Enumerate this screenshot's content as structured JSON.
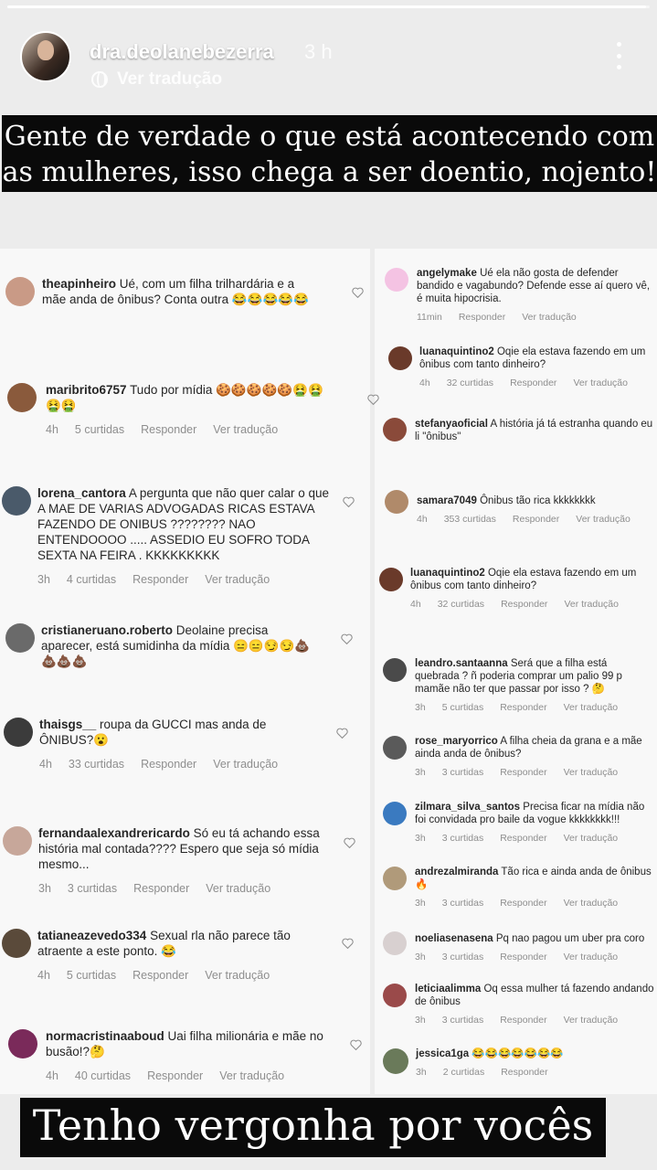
{
  "story": {
    "username": "dra.deolanebezerra",
    "time": "3 h",
    "translate_label": "Ver tradução",
    "progress": 0.995,
    "caption_top": "Gente de verdade o que está acontecendo com as mulheres, isso chega a ser doentio, nojento!",
    "caption_bottom": "Tenho vergonha por vocês"
  },
  "labels": {
    "reply": "Responder",
    "translate": "Ver tradução"
  },
  "left_comments": [
    {
      "user": "theapinheiro",
      "text": "Ué, com um filha trilhardária e a mãe anda de ônibus? Conta outra 😂😂😂😂😂",
      "time": "",
      "likes": ""
    },
    {
      "user": "maribrito6757",
      "text": "Tudo por mídia 🍪🍪🍪🍪🍪🤮🤮🤮🤮",
      "time": "4h",
      "likes": "5 curtidas"
    },
    {
      "user": "lorena_cantora",
      "text": "A pergunta que não quer calar o que A MAE DE VARIAS ADVOGADAS RICAS ESTAVA FAZENDO DE ONIBUS ???????? NAO ENTENDOOOO ..... ASSEDIO EU SOFRO TODA SEXTA NA FEIRA . KKKKKKKKK",
      "time": "3h",
      "likes": "4 curtidas"
    },
    {
      "user": "cristianeruano.roberto",
      "text": "Deolaine precisa aparecer, está sumidinha da mídia 😑😑😏😏💩💩💩💩",
      "time": "",
      "likes": ""
    },
    {
      "user": "thaisgs__",
      "text": "roupa da GUCCI mas anda de ÔNIBUS?😮",
      "time": "4h",
      "likes": "33 curtidas"
    },
    {
      "user": "fernandaalexandrericardo",
      "text": "Só eu tá achando essa história mal contada???? Espero que seja só mídia mesmo...",
      "time": "3h",
      "likes": "3 curtidas"
    },
    {
      "user": "tatianeazevedo334",
      "text": "Sexual rla não parece tão atraente a este ponto. 😂",
      "time": "4h",
      "likes": "5 curtidas"
    },
    {
      "user": "normacristinaaboud",
      "text": "Uai filha milionária e mãe no busão!?🤔",
      "time": "4h",
      "likes": "40 curtidas"
    }
  ],
  "right_comments": [
    {
      "user": "angelymake",
      "text": "Ué ela não gosta de defender bandido e vagabundo? Defende esse aí quero vê, é muita hipocrisia.",
      "time": "11min",
      "likes": ""
    },
    {
      "user": "luanaquintino2",
      "text": "Oqie ela estava fazendo em um ônibus com tanto dinheiro?",
      "time": "4h",
      "likes": "32 curtidas"
    },
    {
      "user": "stefanyaoficial",
      "text": "A história já tá estranha quando eu li \"ônibus\"",
      "time": "",
      "likes": ""
    },
    {
      "user": "samara7049",
      "text": "Ônibus tão rica kkkkkkkk",
      "time": "4h",
      "likes": "353 curtidas"
    },
    {
      "user": "luanaquintino2",
      "text": "Oqie ela estava fazendo em um ônibus com tanto dinheiro?",
      "time": "4h",
      "likes": "32 curtidas"
    },
    {
      "user": "leandro.santaanna",
      "text": "Será que a filha está quebrada ? ñ poderia comprar um palio 99 p mamãe não ter que passar por isso ? 🤔",
      "time": "3h",
      "likes": "5 curtidas"
    },
    {
      "user": "rose_maryorrico",
      "text": "A filha cheia da grana e a mãe ainda anda de ônibus?",
      "time": "3h",
      "likes": "3 curtidas"
    },
    {
      "user": "zilmara_silva_santos",
      "text": "Precisa ficar na mídia não foi convidada pro baile da vogue kkkkkkkk!!!",
      "time": "3h",
      "likes": "3 curtidas"
    },
    {
      "user": "andrezalmiranda",
      "text": "Tão rica e ainda anda de ônibus 🔥",
      "time": "3h",
      "likes": "3 curtidas"
    },
    {
      "user": "noeliasenasena",
      "text": "Pq nao pagou um uber pra coro",
      "time": "3h",
      "likes": "3 curtidas"
    },
    {
      "user": "leticiaalimma",
      "text": "Oq essa mulher tá fazendo andando de ônibus",
      "time": "3h",
      "likes": "3 curtidas"
    },
    {
      "user": "jessica1ga",
      "text": "😂😂😂😂😂😂😂",
      "time": "3h",
      "likes": "2 curtidas"
    }
  ]
}
